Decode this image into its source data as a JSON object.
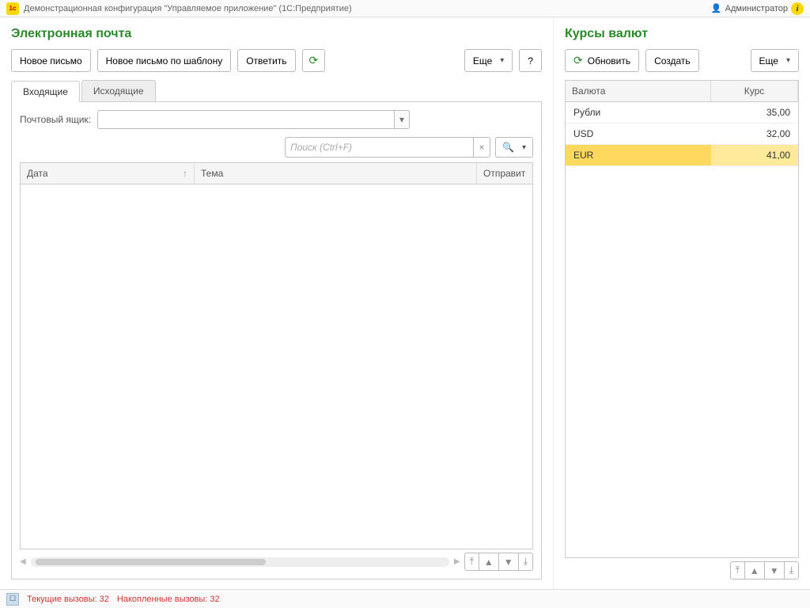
{
  "titlebar": {
    "title": "Демонстрационная конфигурация \"Управляемое приложение\"  (1С:Предприятие)",
    "user": "Администратор"
  },
  "email": {
    "title": "Электронная почта",
    "btn_new": "Новое письмо",
    "btn_new_template": "Новое письмо по шаблону",
    "btn_reply": "Ответить",
    "btn_more": "Еще",
    "btn_help": "?",
    "tab_inbox": "Входящие",
    "tab_outbox": "Исходящие",
    "mailbox_label": "Почтовый ящик:",
    "mailbox_value": "",
    "search_placeholder": "Поиск (Ctrl+F)",
    "col_date": "Дата",
    "col_subject": "Тема",
    "col_sender": "Отправит"
  },
  "rates": {
    "title": "Курсы валют",
    "btn_refresh": "Обновить",
    "btn_create": "Создать",
    "btn_more": "Еще",
    "col_currency": "Валюта",
    "col_rate": "Курс",
    "rows": [
      {
        "name": "Рубли",
        "rate": "35,00"
      },
      {
        "name": "USD",
        "rate": "32,00"
      },
      {
        "name": "EUR",
        "rate": "41,00"
      }
    ],
    "selected_index": 2
  },
  "statusbar": {
    "current_calls": "Текущие вызовы: 32",
    "accumulated_calls": "Накопленные вызовы: 32"
  }
}
